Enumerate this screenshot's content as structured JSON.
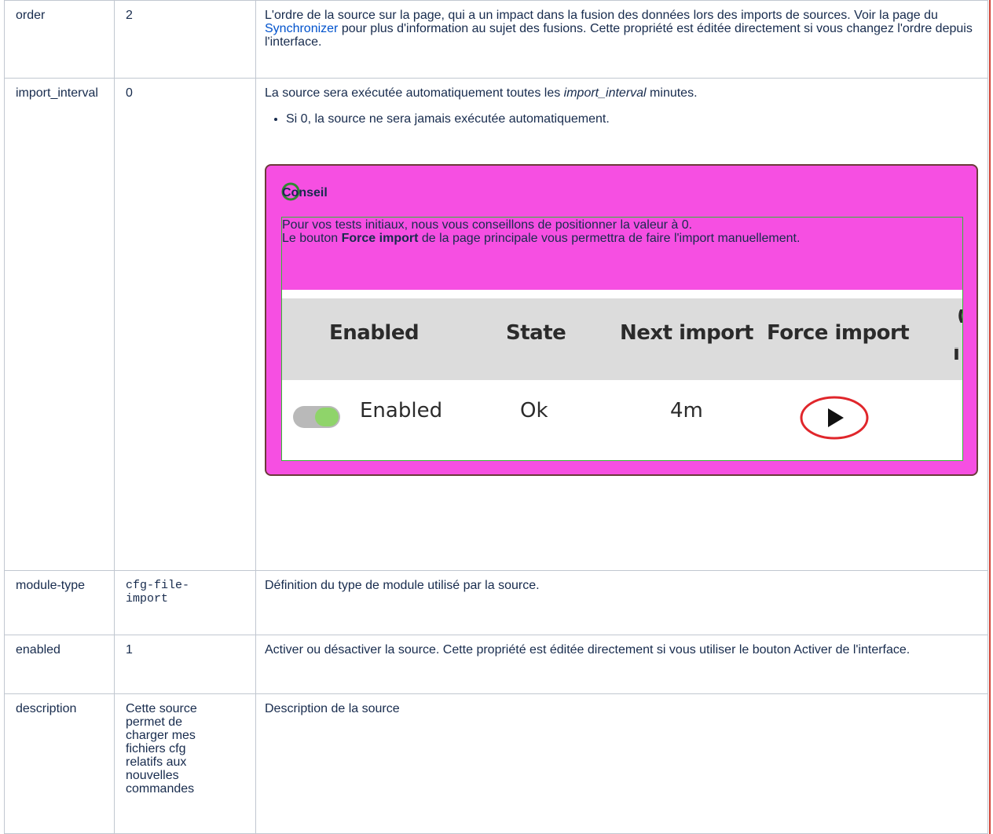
{
  "rows": [
    {
      "key": "order",
      "value": "2",
      "desc_parts": [
        "L'ordre de la source sur la page, qui a un impact dans la fusion des données lors des imports de sources. Voir la page du ",
        "Synchronizer",
        " pour plus d'information au sujet des fusions. Cette propriété est éditée directement si vous changez l'ordre depuis l'interface."
      ]
    },
    {
      "key": "import_interval",
      "value": "0",
      "desc_parts": [
        "La source sera exécutée automatiquement toutes les ",
        "import_interval",
        " minutes."
      ],
      "bullet": "Si 0, la source ne sera jamais exécutée automatiquement.",
      "panel": {
        "title": "Conseil",
        "icon": "tip-icon",
        "line1": "Pour vos tests initiaux, nous vous conseillons de positionner la valeur à 0.",
        "line2_parts": [
          "Le bouton ",
          "Force import",
          " de la page principale vous permettra de faire l'import manuellement."
        ],
        "screenshot": {
          "headers": [
            "Enabled",
            "State",
            "Next import",
            "Force import"
          ],
          "values": [
            "Enabled",
            "Ok",
            "4m"
          ],
          "toggle_on": true
        }
      }
    },
    {
      "key": "module-type",
      "value": "cfg-file-import",
      "desc": "Définition du type de module utilisé par la source."
    },
    {
      "key": "enabled",
      "value": "1",
      "desc": "Activer ou désactiver la source. Cette propriété est éditée directement si vous utiliser le bouton Activer de l'interface."
    },
    {
      "key": "description",
      "value": "Cette source permet de charger mes fichiers cfg relatifs aux nouvelles commandes",
      "desc": "Description de la source"
    }
  ],
  "colors": {
    "panel_bg": "#f64fe2",
    "link": "#0052cc",
    "toggle_knob": "#8fd46a",
    "play_ring": "#e0262b"
  }
}
